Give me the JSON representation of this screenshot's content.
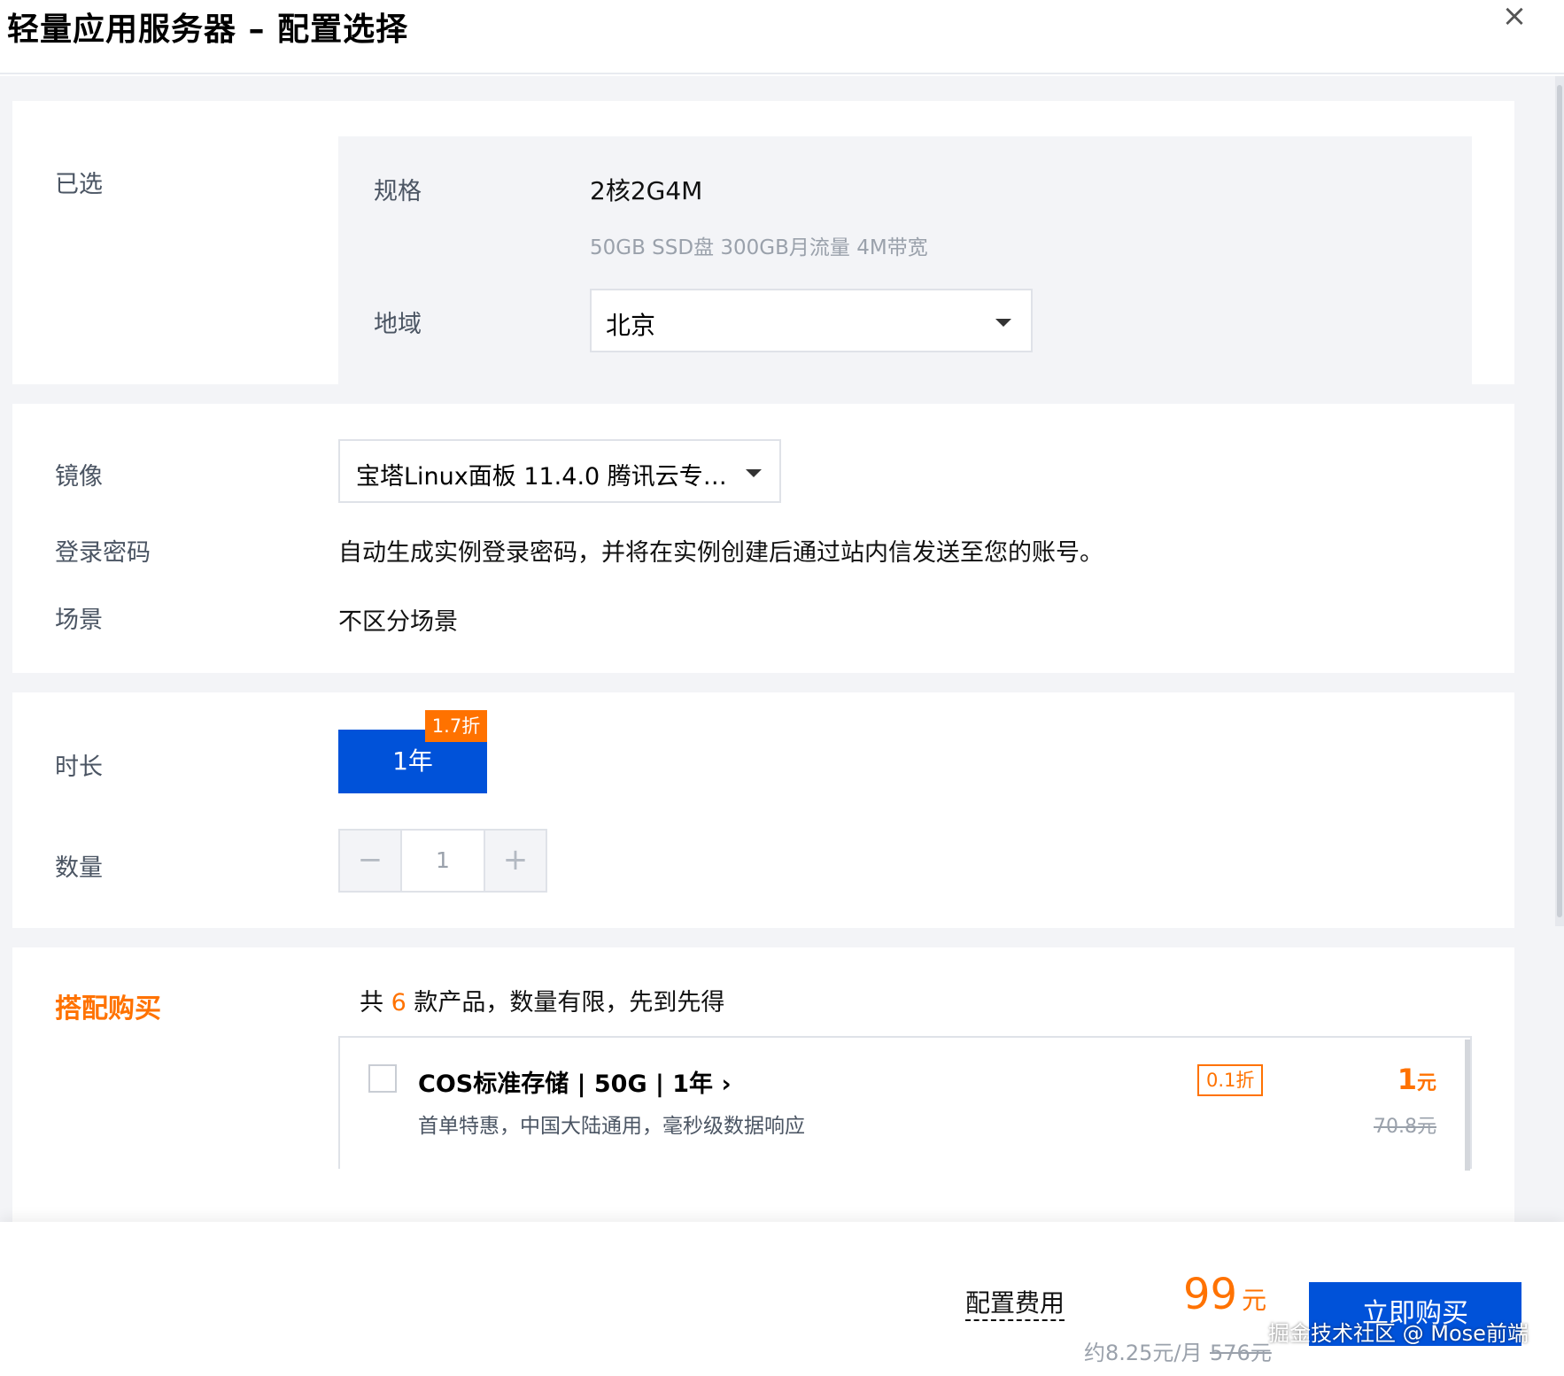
{
  "header": {
    "title": "轻量应用服务器 – 配置选择",
    "close_icon": "×"
  },
  "selected": {
    "label": "已选",
    "spec_label": "规格",
    "spec_value": "2核2G4M",
    "spec_desc": "50GB SSD盘 300GB月流量 4M带宽",
    "region_label": "地域",
    "region_value": "北京"
  },
  "image": {
    "label": "镜像",
    "value": "宝塔Linux面板 11.4.0 腾讯云专…",
    "password_label": "登录密码",
    "password_value": "自动生成实例登录密码，并将在实例创建后通过站内信发送至您的账号。",
    "scene_label": "场景",
    "scene_value": "不区分场景"
  },
  "purchase": {
    "duration_label": "时长",
    "duration_value": "1年",
    "duration_discount": "1.7折",
    "quantity_label": "数量",
    "quantity_value": "1",
    "minus": "−",
    "plus": "+"
  },
  "bundle": {
    "title": "搭配购买",
    "count_prefix": "共",
    "count": "6",
    "count_suffix": "款产品，数量有限，先到先得",
    "products": [
      {
        "name": "COS标准存储 | 50G | 1年 ›",
        "desc": "首单特惠，中国大陆通用，毫秒级数据响应",
        "discount": "0.1折",
        "price": "1",
        "unit": "元",
        "original": "70.8元"
      }
    ]
  },
  "footer": {
    "fee_label": "配置费用",
    "price": "99",
    "unit": "元",
    "monthly": "约8.25元/月",
    "original": "576元",
    "buy_label": "立即购买",
    "watermark": "掘金技术社区 @ Mose前端"
  },
  "colors": {
    "accent": "#0052d9",
    "promo": "#ff7200",
    "background": "#f3f4f7"
  }
}
